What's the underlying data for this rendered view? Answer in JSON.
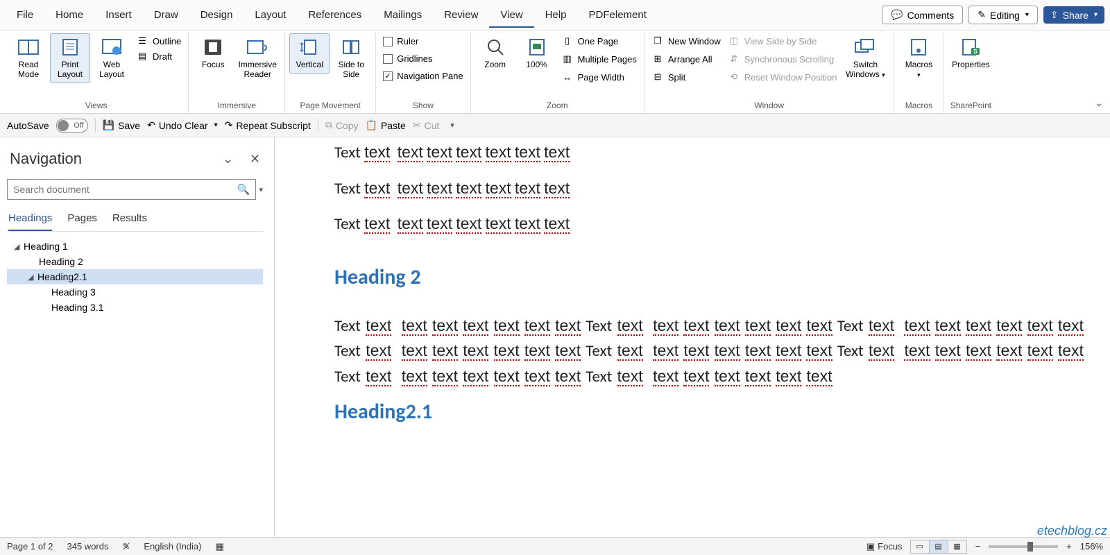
{
  "menu": {
    "tabs": [
      "File",
      "Home",
      "Insert",
      "Draw",
      "Design",
      "Layout",
      "References",
      "Mailings",
      "Review",
      "View",
      "Help",
      "PDFelement"
    ],
    "active": "View",
    "comments": "Comments",
    "editing": "Editing",
    "share": "Share"
  },
  "ribbon": {
    "views": {
      "label": "Views",
      "read_mode": "Read Mode",
      "print_layout": "Print Layout",
      "web_layout": "Web Layout",
      "outline": "Outline",
      "draft": "Draft"
    },
    "immersive": {
      "label": "Immersive",
      "focus": "Focus",
      "immersive_reader": "Immersive Reader"
    },
    "page_movement": {
      "label": "Page Movement",
      "vertical": "Vertical",
      "side_to_side": "Side to Side"
    },
    "show": {
      "label": "Show",
      "ruler": "Ruler",
      "gridlines": "Gridlines",
      "navigation_pane": "Navigation Pane"
    },
    "zoom": {
      "label": "Zoom",
      "zoom": "Zoom",
      "hundred": "100%",
      "one_page": "One Page",
      "multiple_pages": "Multiple Pages",
      "page_width": "Page Width"
    },
    "window": {
      "label": "Window",
      "new_window": "New Window",
      "arrange_all": "Arrange All",
      "split": "Split",
      "view_side": "View Side by Side",
      "sync_scroll": "Synchronous Scrolling",
      "reset_pos": "Reset Window Position",
      "switch": "Switch Windows"
    },
    "macros": {
      "label": "Macros",
      "macros": "Macros"
    },
    "sharepoint": {
      "label": "SharePoint",
      "properties": "Properties"
    }
  },
  "qa": {
    "autosave": "AutoSave",
    "off": "Off",
    "save": "Save",
    "undo": "Undo Clear",
    "redo": "Repeat Subscript",
    "copy": "Copy",
    "paste": "Paste",
    "cut": "Cut"
  },
  "nav": {
    "title": "Navigation",
    "search_placeholder": "Search document",
    "tabs": {
      "headings": "Headings",
      "pages": "Pages",
      "results": "Results"
    },
    "tree": {
      "h1": "Heading 1",
      "h2": "Heading 2",
      "h21": "Heading2.1",
      "h3": "Heading 3",
      "h31": "Heading 3.1"
    }
  },
  "doc": {
    "para_short": "Text text  text text text text text text",
    "heading2": "Heading 2",
    "para_long": "Text text  text text text text text text Text text  text text text text text text Text text  text text text text text text Text text  text text text text text text Text text  text text text text text text Text text  text text text text text text Text text  text text text text text text Text text  text text text text text text",
    "heading21": "Heading2.1"
  },
  "status": {
    "page": "Page 1 of 2",
    "words": "345 words",
    "lang": "English (India)",
    "focus": "Focus",
    "zoom": "156%"
  },
  "watermark": "etechblog.cz"
}
